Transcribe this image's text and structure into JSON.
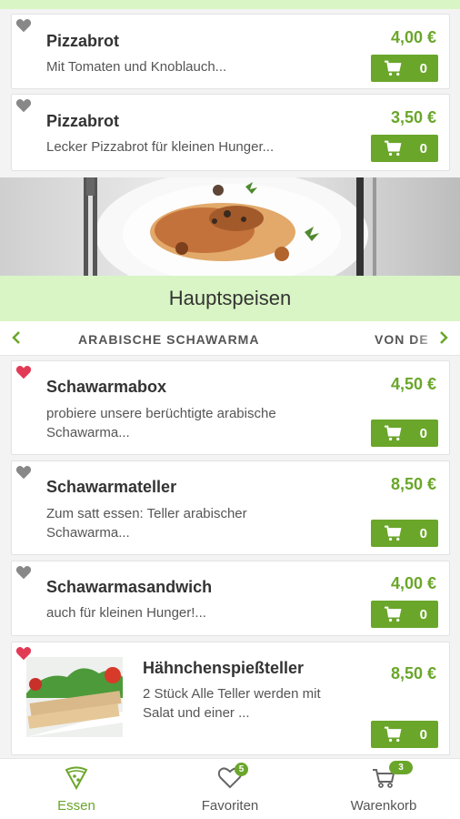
{
  "colors": {
    "accent": "#6aa62a",
    "section_bg": "#d9f5c5",
    "heart_active": "#e23a55",
    "heart_inactive": "#888888"
  },
  "cart_button_icon": "shopping-cart-icon",
  "items_top": [
    {
      "name": "Pizzabrot",
      "description": "Mit Tomaten und Knoblauch...",
      "price": "4,00 €",
      "cart_count": "0",
      "favorite": false
    },
    {
      "name": "Pizzabrot",
      "description": "Lecker Pizzabrot für kleinen Hunger...",
      "price": "3,50 €",
      "cart_count": "0",
      "favorite": false
    }
  ],
  "section": {
    "title": "Hauptspeisen"
  },
  "tabs": {
    "items": [
      "ARABISCHE SCHAWARMA",
      "VON DE"
    ],
    "prev_icon": "chevron-left-icon",
    "next_icon": "chevron-right-icon"
  },
  "items_main": [
    {
      "name": "Schawarmabox",
      "description_line1": "probiere unsere berüchtigte arabische",
      "description_line2": "Schawarma...",
      "price": "4,50 €",
      "cart_count": "0",
      "favorite": true
    },
    {
      "name": "Schawarmateller",
      "description_line1": "Zum satt essen: Teller arabischer",
      "description_line2": "Schawarma...",
      "price": "8,50 €",
      "cart_count": "0",
      "favorite": false
    },
    {
      "name": "Schawarmasandwich",
      "description_line1": "auch für kleinen Hunger!...",
      "description_line2": "",
      "price": "4,00 €",
      "cart_count": "0",
      "favorite": false
    },
    {
      "name": "Hähnchenspießteller",
      "description_line1": "2 Stück Alle Teller werden mit",
      "description_line2": "Salat und einer ...",
      "price": "8,50 €",
      "cart_count": "0",
      "favorite": true
    }
  ],
  "bottom_nav": [
    {
      "label": "Essen",
      "icon": "pizza-slice-icon",
      "active": true
    },
    {
      "label": "Favoriten",
      "icon": "heart-icon",
      "badge": "5"
    },
    {
      "label": "Warenkorb",
      "icon": "shopping-cart-icon",
      "badge": "3"
    }
  ]
}
